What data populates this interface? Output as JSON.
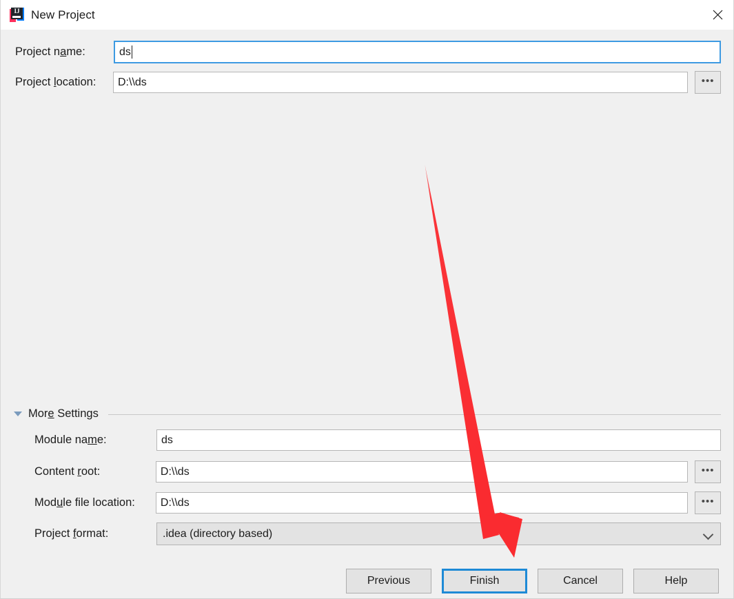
{
  "window": {
    "title": "New Project",
    "app_icon": "intellij-idea-icon",
    "icon_text": "IJ",
    "close_icon": "close-icon"
  },
  "fields": {
    "project_name": {
      "label_before": "Project n",
      "label_mnemonic": "a",
      "label_after": "me:",
      "value": "ds",
      "focused": true
    },
    "project_location": {
      "label_before": "Project ",
      "label_mnemonic": "l",
      "label_after": "ocation:",
      "value": "D:\\\\ds",
      "browse_label": "•••"
    }
  },
  "more_settings": {
    "label_before": "Mor",
    "label_mnemonic": "e",
    "label_after": " Settings",
    "expanded": true,
    "toggle_icon": "triangle-down-icon",
    "fields": {
      "module_name": {
        "label_before": "Module na",
        "label_mnemonic": "m",
        "label_after": "e:",
        "value": "ds"
      },
      "content_root": {
        "label_before": "Content ",
        "label_mnemonic": "r",
        "label_after": "oot:",
        "value": "D:\\\\ds",
        "browse_label": "•••"
      },
      "module_file_location": {
        "label_before": "Mod",
        "label_mnemonic": "u",
        "label_after": "le file location:",
        "value": "D:\\\\ds",
        "browse_label": "•••"
      },
      "project_format": {
        "label_before": "Project ",
        "label_mnemonic": "f",
        "label_after": "ormat:",
        "value": ".idea (directory based)",
        "dropdown_icon": "chevron-down-icon"
      }
    }
  },
  "buttons": {
    "previous": "Previous",
    "finish": "Finish",
    "cancel": "Cancel",
    "help": "Help",
    "default_focused": "Finish"
  },
  "annotation": {
    "type": "arrow",
    "color": "#fa2b30",
    "points_at": "finish-button"
  },
  "colors": {
    "dialog_background": "#f0f0f0",
    "titlebar_background": "#ffffff",
    "field_background": "#ffffff",
    "focus_border": "#3d9ae2",
    "default_button_border": "#1e8ad6",
    "annotation_red": "#fa2b30"
  }
}
